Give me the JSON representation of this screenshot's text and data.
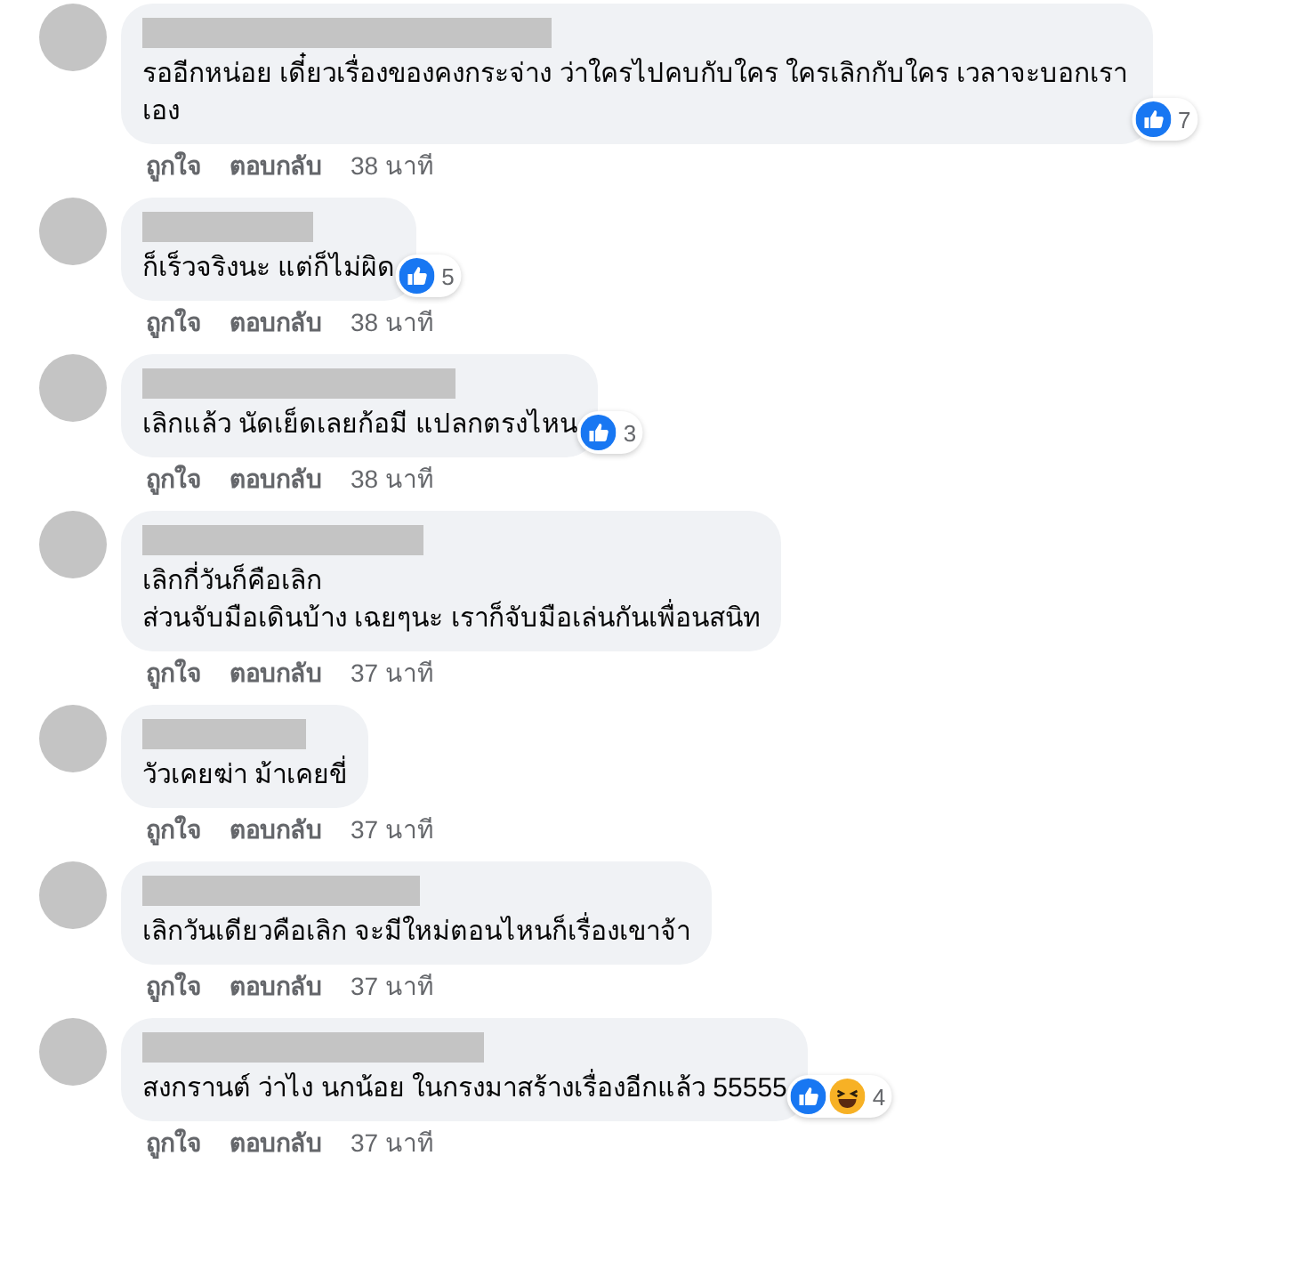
{
  "comments": [
    {
      "text": "รออีกหน่อย เดี๋ยวเรื่องของคงกระจ่าง ว่าใครไปคบกับใคร ใครเลิกกับใคร เวลาจะบอกเราเอง",
      "reactions": [
        {
          "kind": "like"
        }
      ],
      "reaction_count": "7",
      "actions": {
        "like": "ถูกใจ",
        "reply": "ตอบกลับ",
        "time": "38 นาที"
      }
    },
    {
      "text": "ก็เร็วจริงนะ แต่ก็ไม่ผิด",
      "reactions": [
        {
          "kind": "like"
        }
      ],
      "reaction_count": "5",
      "actions": {
        "like": "ถูกใจ",
        "reply": "ตอบกลับ",
        "time": "38 นาที"
      }
    },
    {
      "text": "เลิกแล้ว นัดเย็ดเลยก้อมี แปลกตรงไหน",
      "reactions": [
        {
          "kind": "like"
        }
      ],
      "reaction_count": "3",
      "actions": {
        "like": "ถูกใจ",
        "reply": "ตอบกลับ",
        "time": "38 นาที"
      }
    },
    {
      "text": "เลิกกี่วันก็คือเลิก\nส่วนจับมือเดินบ้าง เฉยๆนะ เราก็จับมือเล่นกันเพื่อนสนิท",
      "actions": {
        "like": "ถูกใจ",
        "reply": "ตอบกลับ",
        "time": "37 นาที"
      }
    },
    {
      "text": "วัวเคยฆ่า ม้าเคยขี่",
      "actions": {
        "like": "ถูกใจ",
        "reply": "ตอบกลับ",
        "time": "37 นาที"
      }
    },
    {
      "text": "เลิกวันเดียวคือเลิก จะมีใหม่ตอนไหนก็เรื่องเขาจ้า",
      "actions": {
        "like": "ถูกใจ",
        "reply": "ตอบกลับ",
        "time": "37 นาที"
      }
    },
    {
      "text": "สงกรานต์ ว่าไง นกน้อย ในกรงมาสร้างเรื่องอีกแล้ว 55555",
      "reactions": [
        {
          "kind": "like"
        },
        {
          "kind": "haha"
        }
      ],
      "reaction_count": "4",
      "actions": {
        "like": "ถูกใจ",
        "reply": "ตอบกลับ",
        "time": "37 นาที"
      }
    }
  ]
}
